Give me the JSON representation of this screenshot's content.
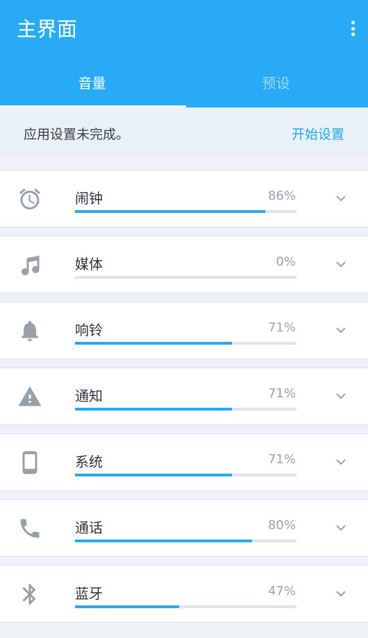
{
  "header": {
    "title": "主界面",
    "menu_icon": "more-vert-icon"
  },
  "tabs": [
    {
      "label": "音量",
      "selected": true
    },
    {
      "label": "预设",
      "selected": false
    }
  ],
  "notice": {
    "text": "应用设置未完成。",
    "action": "开始设置"
  },
  "volumes": [
    {
      "icon": "alarm-clock-icon",
      "label": "闹钟",
      "value": 86,
      "percent": "86%"
    },
    {
      "icon": "music-note-icon",
      "label": "媒体",
      "value": 0,
      "percent": "0%"
    },
    {
      "icon": "bell-icon",
      "label": "响铃",
      "value": 71,
      "percent": "71%"
    },
    {
      "icon": "warning-icon",
      "label": "通知",
      "value": 71,
      "percent": "71%"
    },
    {
      "icon": "phone-device-icon",
      "label": "系统",
      "value": 71,
      "percent": "71%"
    },
    {
      "icon": "phone-call-icon",
      "label": "通话",
      "value": 80,
      "percent": "80%"
    },
    {
      "icon": "bluetooth-icon",
      "label": "蓝牙",
      "value": 47,
      "percent": "47%"
    }
  ],
  "colors": {
    "primary": "#29aaf6",
    "progress": "#26a8f4",
    "icon": "#97a1aa"
  }
}
